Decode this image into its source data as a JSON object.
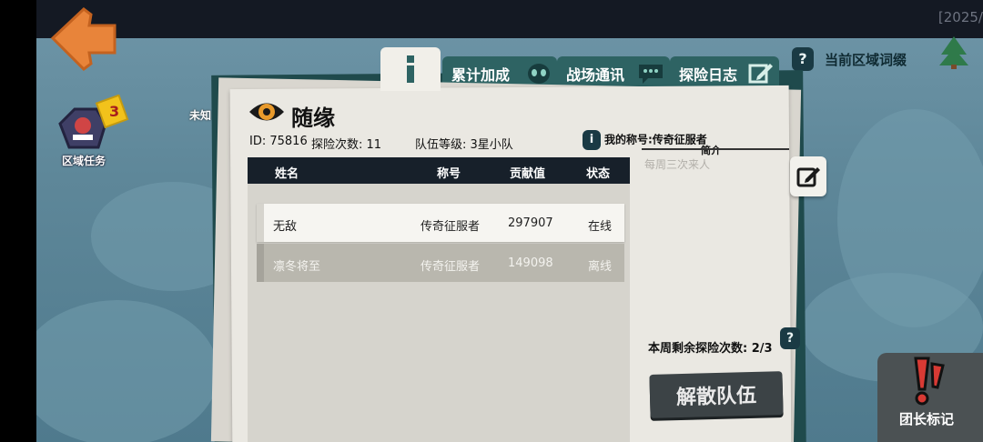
{
  "status_bar": {
    "time_text": "[2025/"
  },
  "hud": {
    "region_label": "当前区域词缀",
    "region_help": "?",
    "quest_label": "区域任务",
    "quest_badge": "3",
    "side_note": "未知"
  },
  "tabs": [
    {
      "label": "",
      "icon": "info-icon"
    },
    {
      "label": "累计加成",
      "icon": "alien-icon"
    },
    {
      "label": "战场通讯",
      "icon": "chat-icon"
    },
    {
      "label": "探险日志",
      "icon": "edit-icon"
    }
  ],
  "team": {
    "name": "随缘",
    "id_text": "ID: 75816",
    "explore_count": "探险次数: 11",
    "level": "队伍等级: 3星小队",
    "my_title": "我的称号:传奇征服者",
    "intro_title": "简介",
    "intro_text": "每周三次来人"
  },
  "table": {
    "headers": [
      "姓名",
      "称号",
      "贡献值",
      "状态"
    ],
    "rows": [
      {
        "name": "无敌",
        "title": "传奇征服者",
        "contribution": "297907",
        "status": "在线"
      },
      {
        "name": "凛冬将至",
        "title": "传奇征服者",
        "contribution": "149098",
        "status": "离线"
      }
    ]
  },
  "weekly": {
    "remaining_text": "本周剩余探险次数:  2/3",
    "help": "?"
  },
  "buttons": {
    "disband": "解散队伍",
    "leader_mark": "团长标记"
  },
  "colors": {
    "board": "#1f4a4c",
    "tab": "#2e6363",
    "paper": "#eae8e2",
    "header": "#17202a"
  }
}
